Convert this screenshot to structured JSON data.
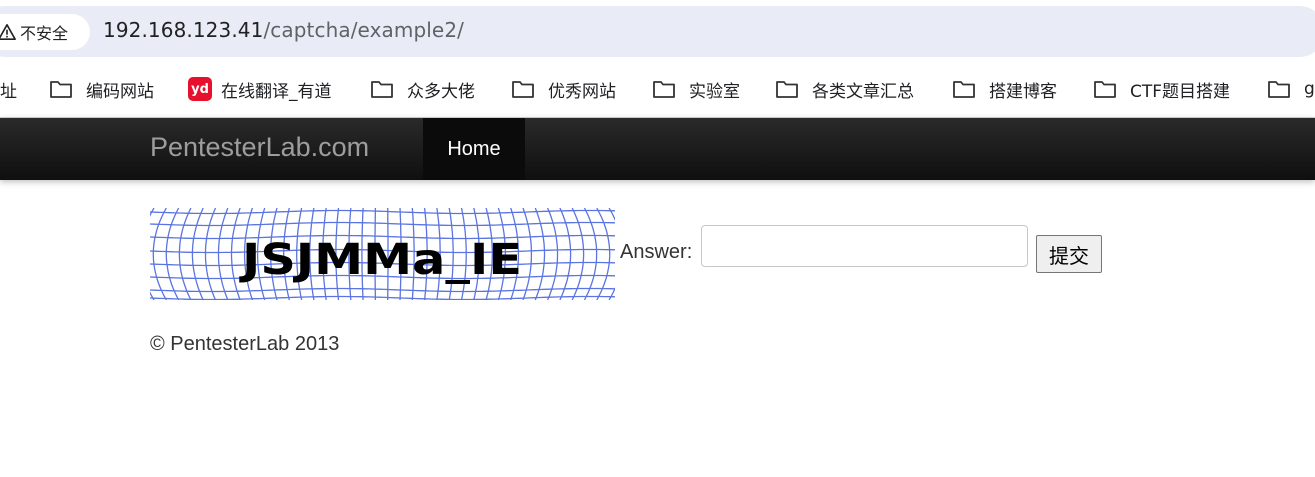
{
  "browser": {
    "security_label": "不安全",
    "url_host": "192.168.123.41",
    "url_path": "/captcha/example2/"
  },
  "bookmarks": [
    {
      "label": "址",
      "icon": "none"
    },
    {
      "label": "编码网站",
      "icon": "folder-icon"
    },
    {
      "label": "在线翻译_有道",
      "icon": "youdao-icon",
      "icon_text": "yd"
    },
    {
      "label": "众多大佬",
      "icon": "folder-icon"
    },
    {
      "label": "优秀网站",
      "icon": "folder-icon"
    },
    {
      "label": "实验室",
      "icon": "folder-icon"
    },
    {
      "label": "各类文章汇总",
      "icon": "folder-icon"
    },
    {
      "label": "搭建博客",
      "icon": "folder-icon"
    },
    {
      "label": "CTF题目搭建",
      "icon": "folder-icon"
    },
    {
      "label": "g",
      "icon": "folder-icon"
    }
  ],
  "navbar": {
    "brand": "PentesterLab.com",
    "home": "Home"
  },
  "captcha": {
    "text": "JSJMMa_IE",
    "grid_color": "#5b74e0"
  },
  "form": {
    "answer_label": "Answer:",
    "answer_value": "",
    "submit_label": "提交"
  },
  "footer": {
    "text": "© PentesterLab 2013"
  }
}
